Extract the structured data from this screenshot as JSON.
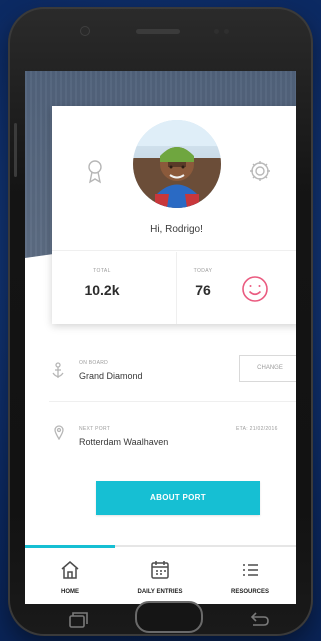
{
  "card": {
    "greeting": "Hi, Rodrigo!",
    "left_icon": "award-icon",
    "right_icon": "gear-icon",
    "stats": [
      {
        "label": "TOTAL",
        "value": "10.2k"
      },
      {
        "label": "TODAY",
        "value": "76"
      }
    ],
    "mood_icon": "smile-icon"
  },
  "sections": {
    "on_board": {
      "label": "ON BOARD",
      "value": "Grand Diamond",
      "icon": "anchor-icon",
      "button": "CHANGE"
    },
    "next_port": {
      "label": "NEXT PORT",
      "value": "Rotterdam Waalhaven",
      "icon": "map-pin-icon",
      "eta": "ETA: 21/02/2016"
    }
  },
  "cta": {
    "label": "ABOUT PORT"
  },
  "tabs": [
    {
      "label": "HOME",
      "icon": "home-icon"
    },
    {
      "label": "DAILY ENTRIES",
      "icon": "calendar-icon"
    },
    {
      "label": "RESOURCES",
      "icon": "list-icon"
    }
  ],
  "colors": {
    "accent": "#16bfd3",
    "smile": "#ea5b80",
    "header": "#5f6e84"
  }
}
